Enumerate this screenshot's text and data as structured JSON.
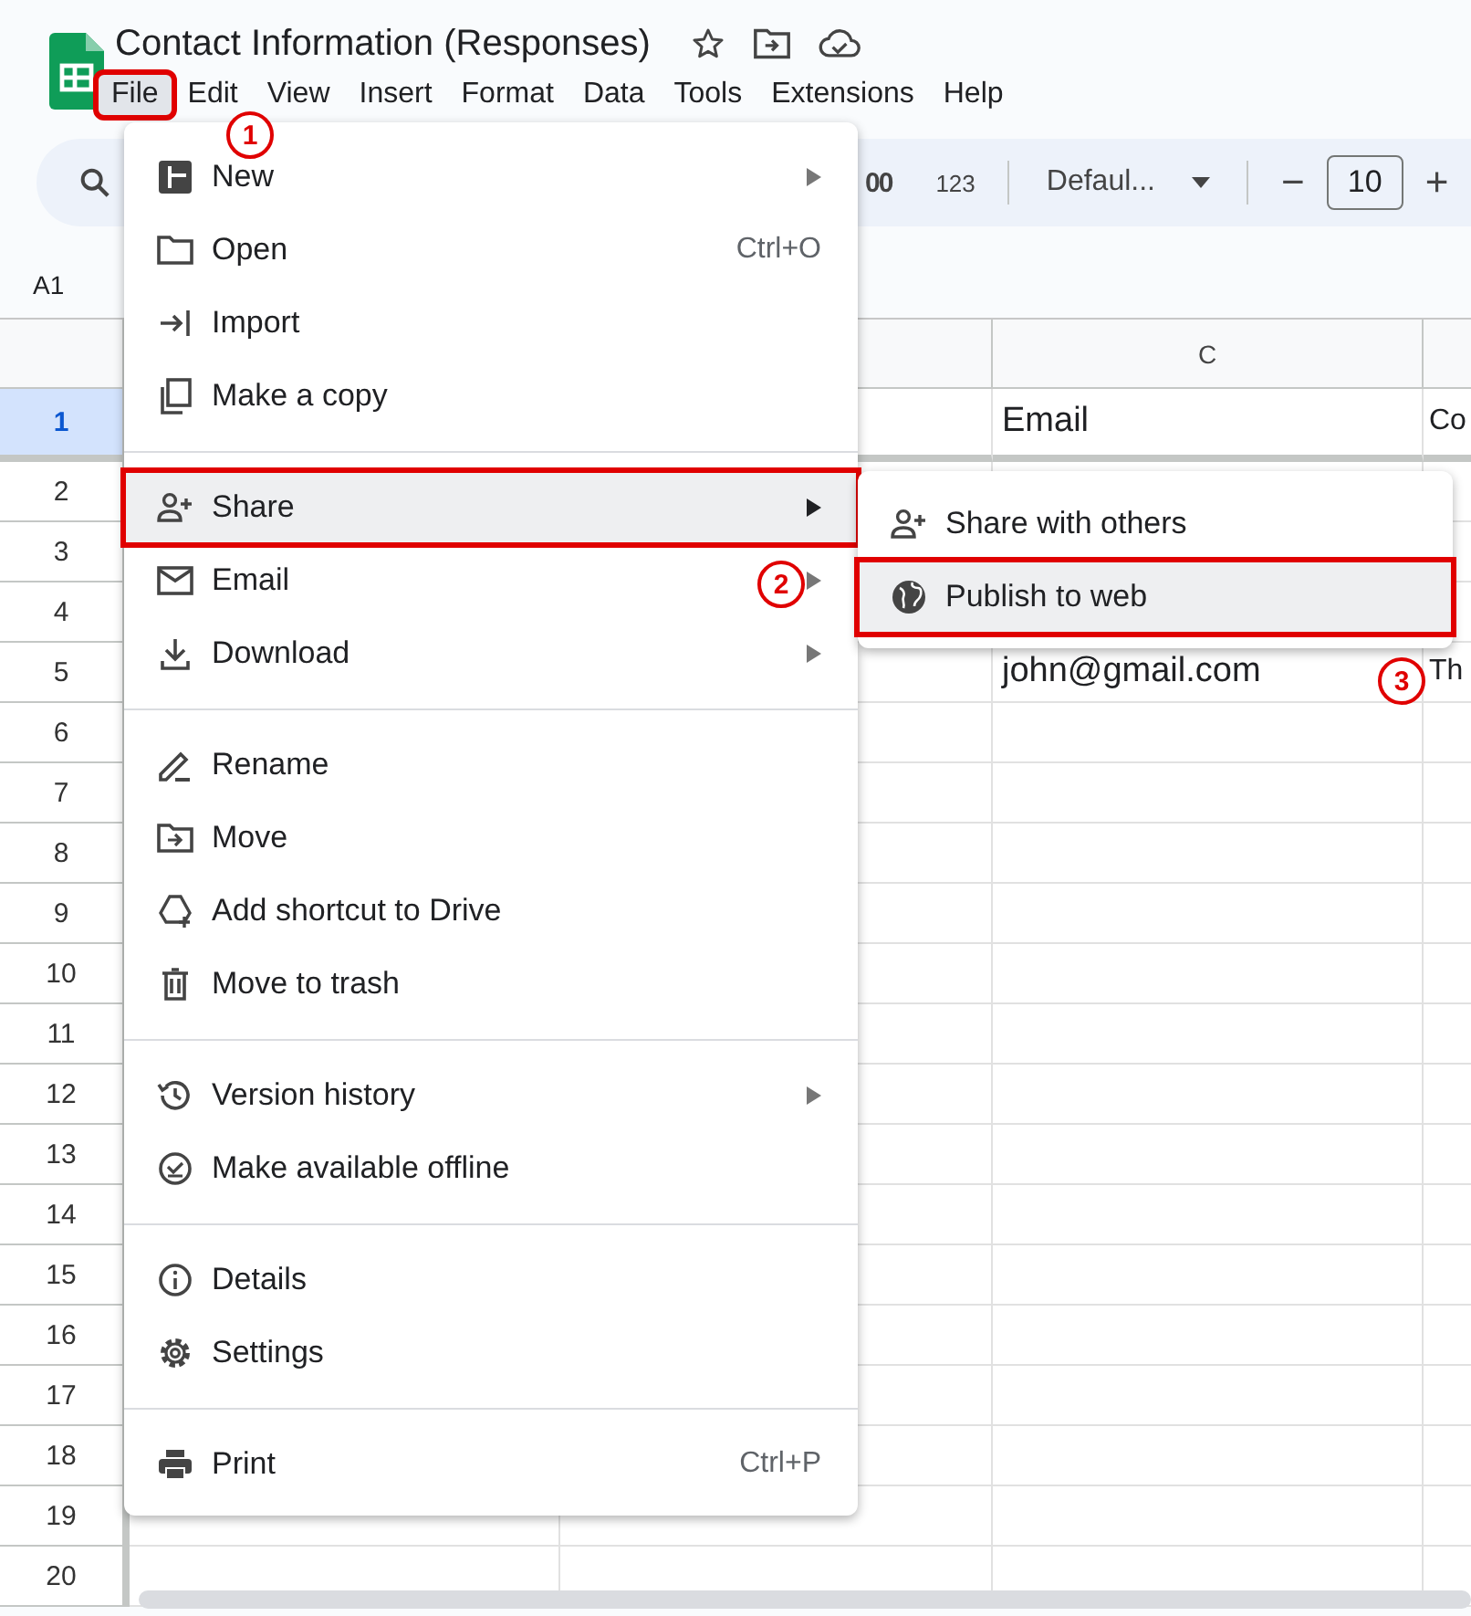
{
  "app": {
    "title": "Contact Information (Responses)",
    "menubar": [
      {
        "label": "File",
        "selected": true,
        "annotated": true
      },
      {
        "label": "Edit",
        "selected": false,
        "annotated": false
      },
      {
        "label": "View",
        "selected": false,
        "annotated": false
      },
      {
        "label": "Insert",
        "selected": false,
        "annotated": false
      },
      {
        "label": "Format",
        "selected": false,
        "annotated": false
      },
      {
        "label": "Data",
        "selected": false,
        "annotated": false
      },
      {
        "label": "Tools",
        "selected": false,
        "annotated": false
      },
      {
        "label": "Extensions",
        "selected": false,
        "annotated": false
      },
      {
        "label": "Help",
        "selected": false,
        "annotated": false
      }
    ]
  },
  "toolbar": {
    "decimal": "00",
    "number_format": "123",
    "font": "Defaul...",
    "font_size": "10",
    "minus": "−",
    "plus": "+"
  },
  "name_box": "A1",
  "sheet": {
    "column_header": "C",
    "rows": [
      {
        "number": "1",
        "selected": true,
        "c": "Email",
        "d": "Co"
      },
      {
        "number": "2",
        "selected": false
      },
      {
        "number": "3",
        "selected": false
      },
      {
        "number": "4",
        "selected": false
      },
      {
        "number": "5",
        "selected": false,
        "c": "john@gmail.com",
        "d": "Th"
      },
      {
        "number": "6",
        "selected": false
      },
      {
        "number": "7",
        "selected": false
      },
      {
        "number": "8",
        "selected": false
      },
      {
        "number": "9",
        "selected": false
      },
      {
        "number": "10",
        "selected": false
      },
      {
        "number": "11",
        "selected": false
      },
      {
        "number": "12",
        "selected": false
      },
      {
        "number": "13",
        "selected": false
      },
      {
        "number": "14",
        "selected": false
      },
      {
        "number": "15",
        "selected": false
      },
      {
        "number": "16",
        "selected": false
      },
      {
        "number": "17",
        "selected": false
      },
      {
        "number": "18",
        "selected": false
      },
      {
        "number": "19",
        "selected": false
      },
      {
        "number": "20",
        "selected": false
      }
    ]
  },
  "file_menu": [
    [
      {
        "label": "New",
        "submenu": true,
        "selected": false,
        "annotated": false
      },
      {
        "label": "Open",
        "shortcut": "Ctrl+O",
        "submenu": false,
        "selected": false,
        "annotated": false
      },
      {
        "label": "Import",
        "submenu": false,
        "selected": false,
        "annotated": false
      },
      {
        "label": "Make a copy",
        "submenu": false,
        "selected": false,
        "annotated": false
      }
    ],
    [
      {
        "label": "Share",
        "submenu": true,
        "selected": true,
        "annotated": true
      },
      {
        "label": "Email",
        "submenu": true,
        "selected": false,
        "annotated": false
      },
      {
        "label": "Download",
        "submenu": true,
        "selected": false,
        "annotated": false
      }
    ],
    [
      {
        "label": "Rename",
        "submenu": false,
        "selected": false,
        "annotated": false
      },
      {
        "label": "Move",
        "submenu": false,
        "selected": false,
        "annotated": false
      },
      {
        "label": "Add shortcut to Drive",
        "submenu": false,
        "selected": false,
        "annotated": false
      },
      {
        "label": "Move to trash",
        "submenu": false,
        "selected": false,
        "annotated": false
      }
    ],
    [
      {
        "label": "Version history",
        "submenu": true,
        "selected": false,
        "annotated": false
      },
      {
        "label": "Make available offline",
        "submenu": false,
        "selected": false,
        "annotated": false
      }
    ],
    [
      {
        "label": "Details",
        "submenu": false,
        "selected": false,
        "annotated": false
      },
      {
        "label": "Settings",
        "submenu": false,
        "selected": false,
        "annotated": false
      }
    ],
    [
      {
        "label": "Print",
        "shortcut": "Ctrl+P",
        "submenu": false,
        "selected": false,
        "annotated": false
      }
    ]
  ],
  "share_submenu": [
    {
      "label": "Share with others",
      "selected": false,
      "annotated": false
    },
    {
      "label": "Publish to web",
      "selected": true,
      "annotated": true
    }
  ],
  "callouts": [
    {
      "number": "1"
    },
    {
      "number": "2"
    },
    {
      "number": "3"
    }
  ]
}
